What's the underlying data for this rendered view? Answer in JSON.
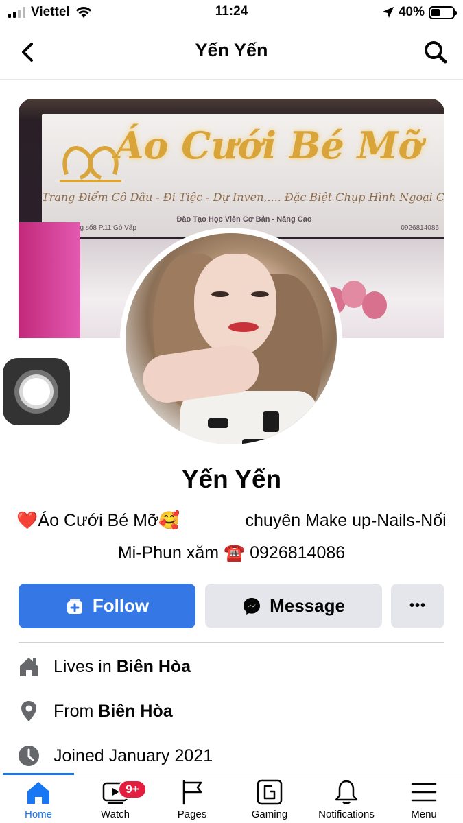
{
  "status_bar": {
    "carrier": "Viettel",
    "time": "11:24",
    "battery_percent": "40%",
    "battery_level": 0.4,
    "signal_bars_active": 2,
    "signal_bars_total": 4
  },
  "header": {
    "title": "Yến Yến"
  },
  "cover": {
    "sign_title": "Áo Cưới Bé Mỡ",
    "sign_subtitle": "Trang Điểm Cô Dâu - Đi Tiệc - Dự Inven,.... Đặc Biệt Chụp Hình Ngoại Cảnh",
    "sign_training": "Đào Tạo Học Viên Cơ Bản - Nâng Cao",
    "sign_address": "240 Đường số8 P.11 Gò Vấp",
    "sign_phone": "0926814086"
  },
  "profile": {
    "name": "Yến Yến",
    "bio_part1": "❤️Áo Cưới Bé Mỡ🥰",
    "bio_part2": "chuyên Make up-Nails-Nối Mi-Phun xăm ☎️ 0926814086"
  },
  "actions": {
    "follow_label": "Follow",
    "message_label": "Message",
    "more_label": "•••"
  },
  "intro": {
    "lives_prefix": "Lives in ",
    "lives_place": "Biên Hòa",
    "from_prefix": "From ",
    "from_place": "Biên Hòa",
    "joined": "Joined January 2021"
  },
  "tabbar": {
    "tabs": [
      {
        "label": "Home",
        "icon": "home-icon",
        "active": true
      },
      {
        "label": "Watch",
        "icon": "watch-icon",
        "badge": "9+"
      },
      {
        "label": "Pages",
        "icon": "pages-flag-icon"
      },
      {
        "label": "Gaming",
        "icon": "gaming-icon"
      },
      {
        "label": "Notifications",
        "icon": "bell-icon"
      },
      {
        "label": "Menu",
        "icon": "hamburger-icon"
      }
    ]
  },
  "colors": {
    "accent": "#1877f2",
    "follow_button": "#3578e5",
    "secondary_button": "#e4e6eb",
    "badge": "#e41e3f"
  }
}
